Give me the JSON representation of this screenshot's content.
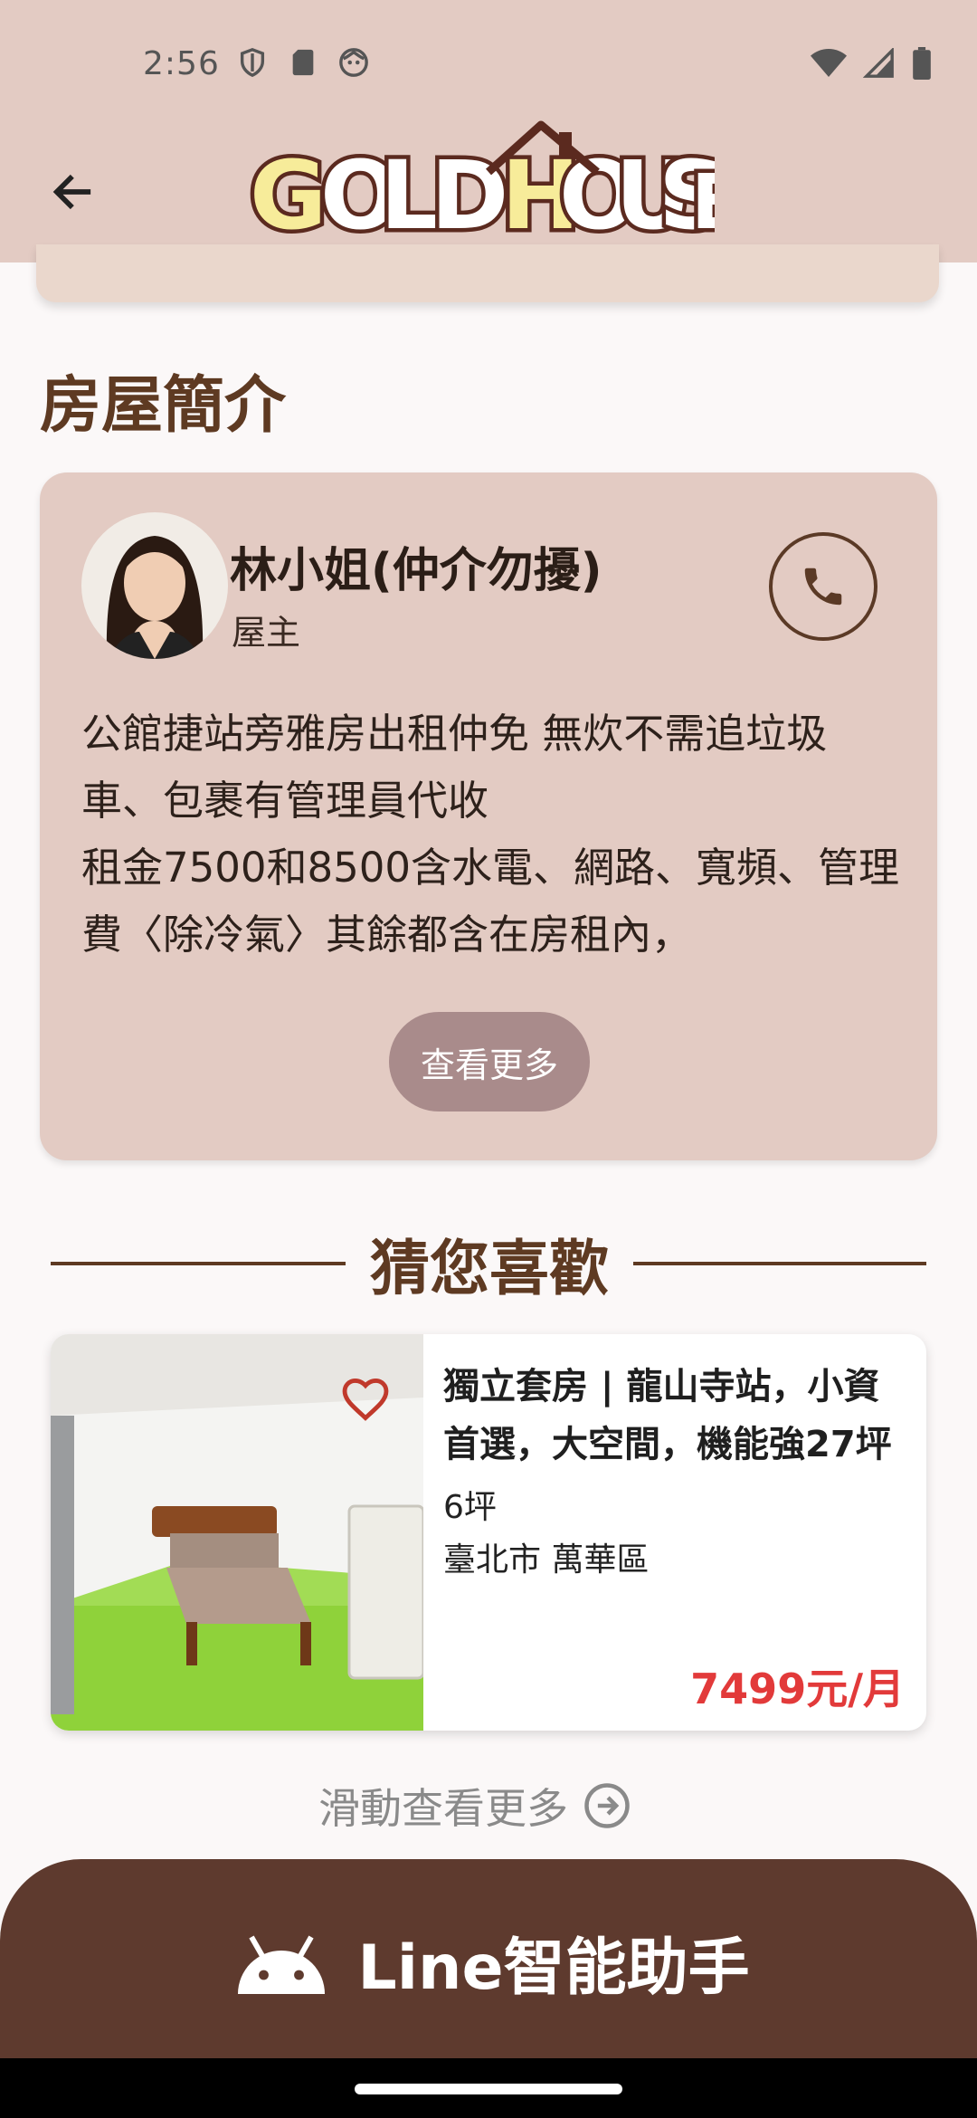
{
  "status_bar": {
    "time": "2:56"
  },
  "app_bar": {
    "logo_text": "GOLD HOUSE"
  },
  "intro": {
    "section_title": "房屋簡介",
    "owner_name": "林小姐(仲介勿擾)",
    "owner_role": "屋主",
    "description": "公館捷站旁雅房出租仲免 無炊不需追垃圾車、包裹有管理員代收\n租金7500和8500含水電、網路、寬頻、管理費〈除冷氣〉其餘都含在房租內，",
    "more_label": "查看更多"
  },
  "recommend": {
    "title": "猜您喜歡",
    "listing": {
      "title": "獨立套房 | 龍山寺站，小資首選，大空間，機能強27坪",
      "size": "6坪",
      "area": "臺北市 萬華區",
      "price": "7499元/月"
    },
    "swipe_hint": "滑動查看更多"
  },
  "bottom_banner": {
    "label": "Line智能助手"
  },
  "colors": {
    "app_bar": "#e3cbc3",
    "brand_brown": "#5e3a22",
    "price_red": "#e23a3a",
    "banner": "#5e3a2e",
    "more_button": "#a98b8b"
  },
  "icons": [
    "back-arrow-icon",
    "phone-icon",
    "heart-icon",
    "arrow-right-circle-icon",
    "android-icon"
  ]
}
